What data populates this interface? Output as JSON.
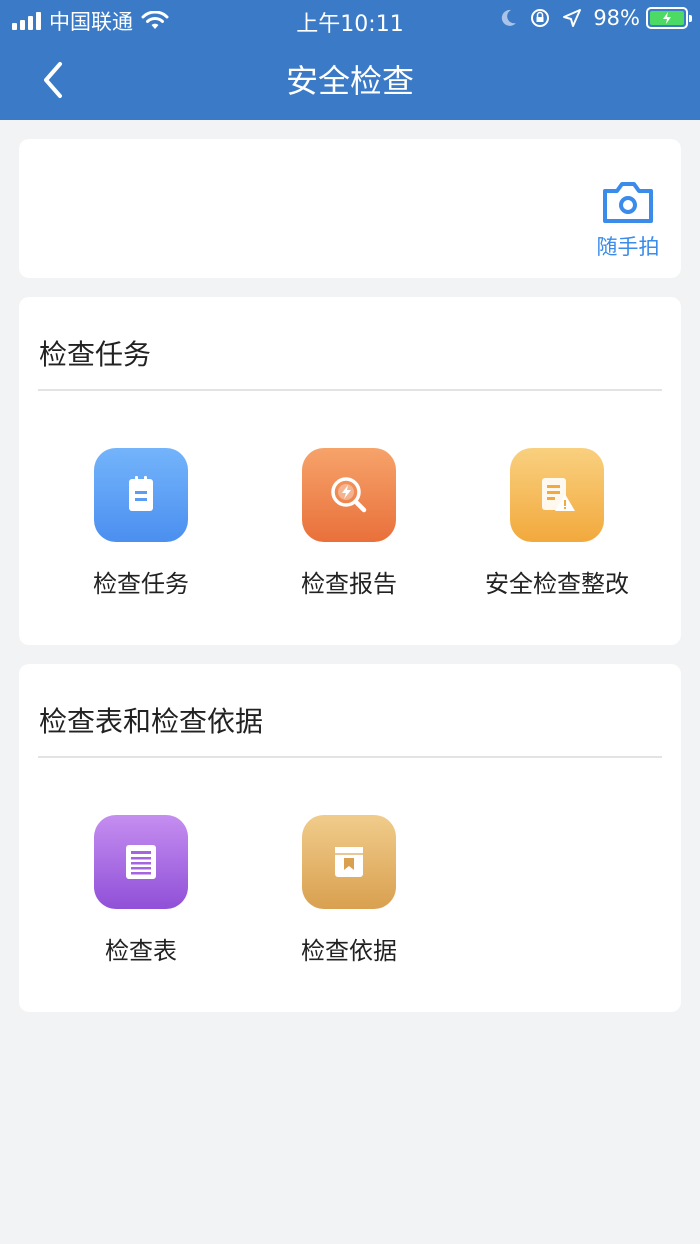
{
  "status_bar": {
    "carrier": "中国联通",
    "time": "上午10:11",
    "battery": "98%",
    "icons": [
      "signal-icon",
      "wifi-icon",
      "moon-icon",
      "rotation-lock-icon",
      "location-icon",
      "battery-icon"
    ]
  },
  "header": {
    "title": "安全检查",
    "back_icon": "chevron-left-icon",
    "color": "#3a7ac6"
  },
  "quick_action": {
    "label": "随手拍",
    "icon": "camera-icon",
    "color": "#3a8bea"
  },
  "sections": [
    {
      "title": "检查任务",
      "items": [
        {
          "label": "检查任务",
          "icon": "clipboard-icon",
          "color": "#5b9df5"
        },
        {
          "label": "检查报告",
          "icon": "search-report-icon",
          "color": "#ee8146"
        },
        {
          "label": "安全检查整改",
          "icon": "warning-document-icon",
          "color": "#f4b64e"
        }
      ]
    },
    {
      "title": "检查表和检查依据",
      "items": [
        {
          "label": "检查表",
          "icon": "list-sheet-icon",
          "color": "#a565e0"
        },
        {
          "label": "检查依据",
          "icon": "bookmark-box-icon",
          "color": "#e2b265"
        }
      ]
    }
  ]
}
